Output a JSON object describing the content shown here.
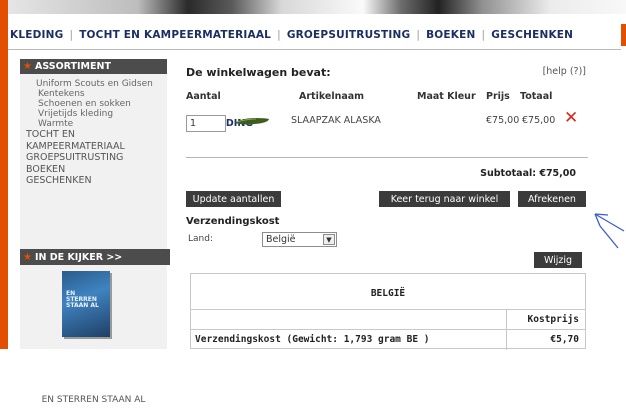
{
  "nav": {
    "items": [
      "KLEDING",
      "TOCHT EN KAMPEERMATERIAAL",
      "GROEPSUITRUSTING",
      "BOEKEN",
      "GESCHENKEN"
    ]
  },
  "sidebar": {
    "heading": "ASSORTIMENT",
    "menu": [
      {
        "label": "KLEDING",
        "level": "main"
      },
      {
        "label": "Uniform Scouts en Gidsen",
        "level": "sub"
      },
      {
        "label": "Kentekens",
        "level": "subsub"
      },
      {
        "label": "Schoenen en sokken",
        "level": "subsub"
      },
      {
        "label": "Vrijetijds kleding",
        "level": "subsub"
      },
      {
        "label": "Warmte",
        "level": "subsub"
      },
      {
        "label": "TOCHT EN KAMPEERMATERIAAL",
        "level": "lvl1"
      },
      {
        "label": "GROEPSUITRUSTING",
        "level": "lvl1"
      },
      {
        "label": "BOEKEN",
        "level": "lvl1"
      },
      {
        "label": "GESCHENKEN",
        "level": "lvl1"
      }
    ],
    "kijker_heading": "IN DE KIJKER >>",
    "book_caption": "EN STERREN STAAN AL",
    "book_title": "EN STERREN STAAN AL"
  },
  "cart": {
    "title": "De winkelwagen bevat:",
    "help": "[help (?)]",
    "headers": {
      "qty": "Aantal",
      "name": "Artikelnaam",
      "size_color": "Maat Kleur",
      "price": "Prijs",
      "total": "Totaal"
    },
    "item": {
      "qty": "1",
      "name": "SLAAPZAK ALASKA",
      "price": "€75,00",
      "total": "€75,00"
    },
    "subtotal": "Subtotaal: €75,00",
    "buttons": {
      "update": "Update aantallen",
      "back": "Keer terug naar winkel",
      "checkout": "Afrekenen",
      "change": "Wijzig"
    }
  },
  "shipping": {
    "heading": "Verzendingskost",
    "country_label": "Land:",
    "country_value": "België",
    "table": {
      "country": "BELGIË",
      "col_header": "Kostprijs",
      "row_label": "Verzendingskost (Gewicht: 1,793 gram BE )",
      "row_value": "€5,70"
    }
  },
  "colors": {
    "accent": "#e24f00",
    "nav_text": "#1c2f63",
    "button_bg": "#3b3b3b",
    "delete_red": "#d9261c",
    "annotation_blue": "#3b5bd6"
  }
}
